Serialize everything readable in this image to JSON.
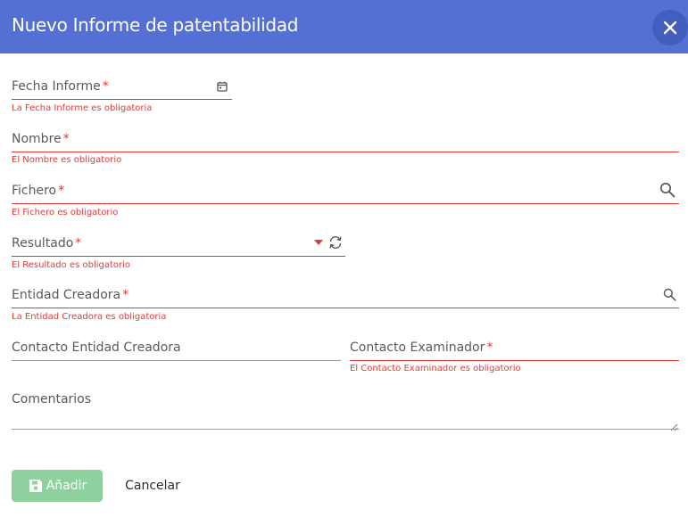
{
  "dialog": {
    "title": "Nuevo Informe de patentabilidad",
    "close_icon": "close-icon"
  },
  "fields": {
    "fecha_informe": {
      "label": "Fecha Informe",
      "required_mark": "*",
      "error": "La Fecha Informe es obligatoria",
      "icon": "calendar-icon"
    },
    "nombre": {
      "label": "Nombre",
      "required_mark": "*",
      "error": "El Nombre es obligatorio"
    },
    "fichero": {
      "label": "Fichero",
      "required_mark": "*",
      "error": "El Fichero es obligatorio",
      "icon": "search-icon"
    },
    "resultado": {
      "label": "Resultado",
      "required_mark": "*",
      "error": "El Resultado es obligatorio",
      "icons": [
        "dropdown-arrow-icon",
        "refresh-icon"
      ]
    },
    "entidad_creadora": {
      "label": "Entidad Creadora",
      "required_mark": "*",
      "error": "La Entidad Creadora es obligatoria",
      "icon": "search-icon"
    },
    "contacto_entidad_creadora": {
      "label": "Contacto Entidad Creadora"
    },
    "contacto_examinador": {
      "label": "Contacto Examinador",
      "required_mark": "*",
      "error": "El Contacto Examinador es obligatorio"
    },
    "comentarios": {
      "label": "Comentarios"
    }
  },
  "actions": {
    "add_label": "Añadir",
    "add_icon": "save-icon",
    "cancel_label": "Cancelar"
  },
  "colors": {
    "header": "#5470d4",
    "error": "#e53935",
    "add_button": "#8fd19e"
  }
}
